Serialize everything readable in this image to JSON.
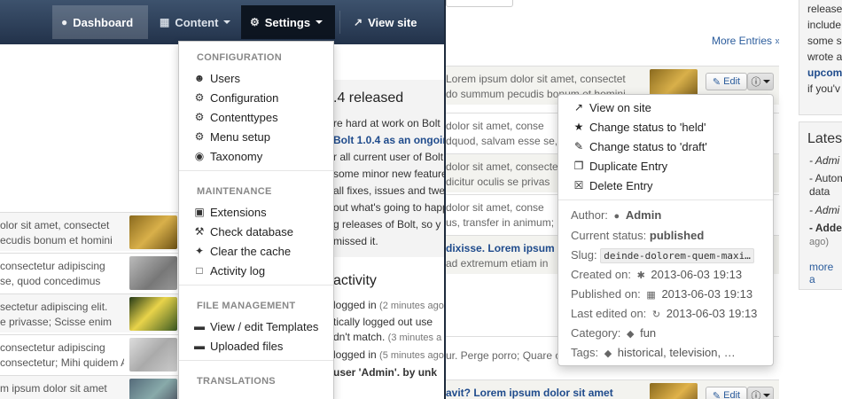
{
  "navbar": {
    "dashboard": "Dashboard",
    "content": "Content",
    "settings": "Settings",
    "view_site": "View site"
  },
  "settings_menu": {
    "configuration_header": "CONFIGURATION",
    "users": "Users",
    "configuration": "Configuration",
    "contenttypes": "Contenttypes",
    "menu_setup": "Menu setup",
    "taxonomy": "Taxonomy",
    "maintenance_header": "MAINTENANCE",
    "extensions": "Extensions",
    "check_database": "Check database",
    "clear_cache": "Clear the cache",
    "activity_log": "Activity log",
    "file_management_header": "FILE MANAGEMENT",
    "view_edit_templates": "View / edit Templates",
    "uploaded_files": "Uploaded files",
    "translations_header": "TRANSLATIONS"
  },
  "news": {
    "title": ".4 released",
    "lines": [
      "re hard at work on Bolt",
      "Bolt 1.0.4 as an ongoin",
      "r all current user of Bolt",
      "some minor new feature",
      "all fixes, issues and twea",
      "out what's going to happ",
      "g releases of Bolt, so y",
      "missed it."
    ]
  },
  "activity": {
    "title": "activity",
    "lines": [
      {
        "text": "logged in ",
        "time": "(2 minutes ago"
      },
      {
        "text": "tically logged out use",
        "time": ""
      },
      {
        "text": "dn't match. ",
        "time": "(3 minutes a"
      },
      {
        "text": "logged in ",
        "time": "(5 minutes ago"
      },
      {
        "text": "user 'Admin'. by unk",
        "time": ""
      }
    ]
  },
  "left_rows": [
    {
      "t1": "olor sit amet, consectet",
      "t2": "ecudis bonum et homini"
    },
    {
      "t1": " consectetur adipiscing",
      "t2": "se, quod concedimus"
    },
    {
      "t1": "sectetur adipiscing elit.",
      "t2": "e privasse; Scisse enim"
    },
    {
      "t1": " consectetur adipiscing",
      "t2": "consectetur; Mihi quidem An"
    },
    {
      "t1": "m ipsum dolor sit amet",
      "t2": ""
    }
  ],
  "right_header": {
    "more_entries": "More Entries »"
  },
  "right_rows": [
    {
      "t1": "Lorem ipsum dolor sit amet, consectet",
      "t2": "do summum pecudis bonum et homini"
    },
    {
      "t1": "dolor sit amet, conse",
      "t2": "dquod, salvam esse se, quod"
    },
    {
      "t1": "dolor sit amet, consectet",
      "t2": "dicitur oculis se privas"
    },
    {
      "t1": "dolor sit amet, conse",
      "t2": "us, transfer in animum;"
    },
    {
      "t1": "dixisse. Lorem ipsum",
      "t2": "ad extremum etiam in"
    },
    {
      "t1": "",
      "t2": "ur. Perge porro; Quare conare, quaeso."
    },
    {
      "t1": "avit? Lorem ipsum dolor sit amet",
      "t2": ""
    }
  ],
  "buttons": {
    "edit": "Edit"
  },
  "sidebar": {
    "top_lines": [
      "release",
      "include",
      "some s",
      "wrote a",
      "upcom",
      "if you'v"
    ],
    "latest_title": "Lates",
    "latest_items": [
      "- Admi",
      "- Autom",
      "  data",
      "- Admi",
      "- Adde",
      "  ago)"
    ],
    "latest_more": "more a"
  },
  "info_popover": {
    "view_on_site": "View on site",
    "status_held": "Change status to 'held'",
    "status_draft": "Change status to 'draft'",
    "duplicate": "Duplicate Entry",
    "delete": "Delete Entry",
    "author_label": "Author:",
    "author_value": "Admin",
    "status_label": "Current status:",
    "status_value": "published",
    "slug_label": "Slug:",
    "slug_value": "deinde-dolorem-quem-maxi…",
    "created_label": "Created on:",
    "created_value": "2013-06-03 19:13",
    "published_label": "Published on:",
    "published_value": "2013-06-03 19:13",
    "edited_label": "Last edited on:",
    "edited_value": "2013-06-03 19:13",
    "category_label": "Category:",
    "category_value": "fun",
    "tags_label": "Tags:",
    "tags_value": "historical, television, …"
  },
  "colors": {
    "navbar_top": "#3d526d",
    "navbar_bottom": "#22324a",
    "settings_active": "#0d1520",
    "link": "#2b5c9c"
  }
}
